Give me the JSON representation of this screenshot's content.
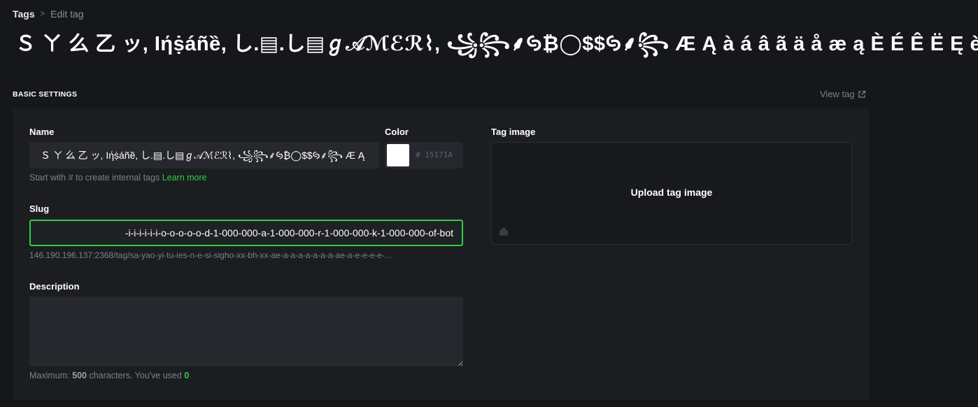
{
  "breadcrumb": {
    "root": "Tags",
    "separator": ">",
    "current": "Edit tag"
  },
  "page_title": "Ｓ ㄚ 么 乙 ッ, Iήṩáñȅ, し.▤.し▤ℊ𝒜ℳℰℛ⌇, ꧁꧂⸙ꚸ₿◯$$ꚸ⸙꧂ Æ Ą à á â ã ä å æ ą È É Ê Ë Ę è é",
  "section": {
    "label": "BASIC SETTINGS",
    "view_tag": "View tag"
  },
  "name": {
    "label": "Name",
    "value": "Ｓ ㄚ 么 乙 ッ, Iήṩáñȅ, し.▤.し▤ℊ𝒜ℳℰℛ⌇, ꧁꧂⸙ꚸ₿◯$$ꚸ⸙꧂ Æ Ą",
    "hint_prefix": "Start with # to create internal tags",
    "hint_link": "Learn more"
  },
  "color": {
    "label": "Color",
    "swatch": "#ffffff",
    "hex_placeholder": "# 15171A"
  },
  "slug": {
    "label": "Slug",
    "value": "-i-i-i-i-i-i-o-o-o-o-o-d-1-000-000-a-1-000-000-r-1-000-000-k-1-000-000-of-bot",
    "url_preview": "146.190.196.137:2368/tag/sa-yao-yi-tu-ies-n-e-si-sigho-xx-bh-xx-ae-a-a-a-a-a-a-a-ae-a-e-e-e-e-..."
  },
  "description": {
    "label": "Description",
    "value": "",
    "counter_prefix": "Maximum:",
    "max": "500",
    "counter_middle": "characters. You've used",
    "used": "0"
  },
  "tag_image": {
    "label": "Tag image",
    "upload_label": "Upload tag image"
  },
  "colors": {
    "background": "#15171a",
    "panel": "#1b1d21",
    "field": "#26282d",
    "accent_green": "#30cf43",
    "muted_text": "#7c8189"
  }
}
